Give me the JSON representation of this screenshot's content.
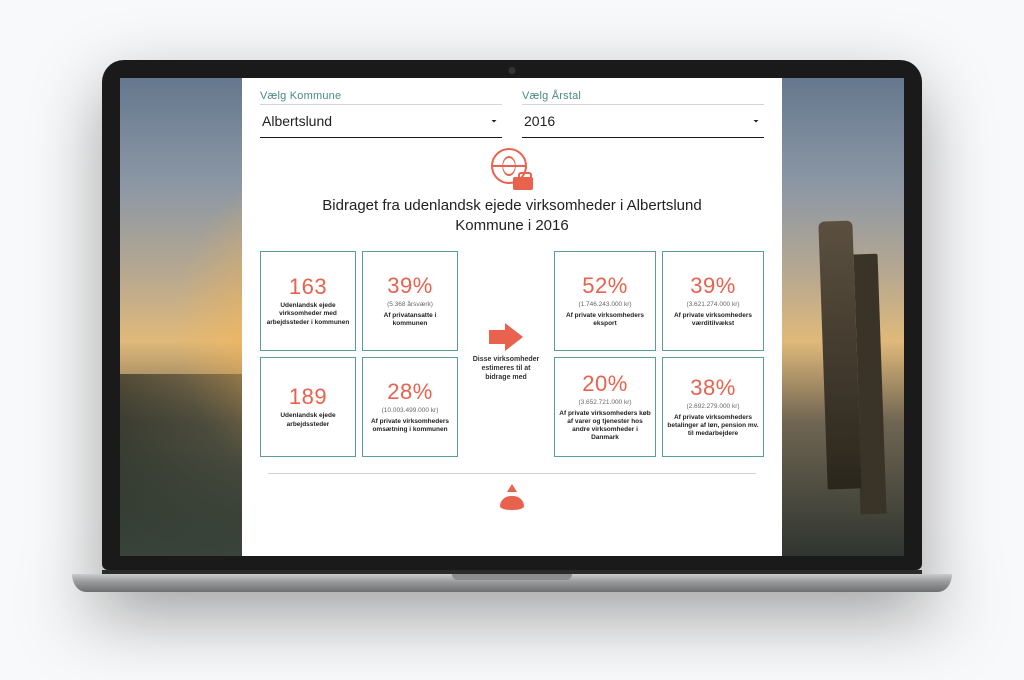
{
  "selectors": {
    "kommune_label": "Vælg Kommune",
    "kommune_value": "Albertslund",
    "year_label": "Vælg Årstal",
    "year_value": "2016"
  },
  "headline": "Bidraget fra udenlandsk ejede virksomheder i Albertslund Kommune i 2016",
  "arrow_caption": "Disse virksomheder estimeres til at bidrage med",
  "left_cards": [
    {
      "value": "163",
      "sub": "",
      "desc": "Udenlandsk ejede virksomheder med arbejdssteder i kommunen"
    },
    {
      "value": "39%",
      "sub": "(5.368 årsværk)",
      "desc": "Af privatansatte i kommunen"
    },
    {
      "value": "189",
      "sub": "",
      "desc": "Udenlandsk ejede arbejdssteder"
    },
    {
      "value": "28%",
      "sub": "(10.003.499.000 kr)",
      "desc": "Af private virksomheders omsætning i kommunen"
    }
  ],
  "right_cards": [
    {
      "value": "52%",
      "sub": "(1.746.243.000 kr)",
      "desc": "Af private virksomheders eksport"
    },
    {
      "value": "39%",
      "sub": "(3.621.274.000 kr)",
      "desc": "Af private virksomheders værditilvækst"
    },
    {
      "value": "20%",
      "sub": "(3.652.721.000 kr)",
      "desc": "Af private virksomheders køb af varer og tjenester hos andre virksomheder i Danmark"
    },
    {
      "value": "38%",
      "sub": "(2.692.279.000 kr)",
      "desc": "Af private virksomheders betalinger af løn, pension mv. til medarbejdere"
    }
  ],
  "colors": {
    "accent": "#e8624d",
    "card_border": "#5a9e9b"
  }
}
